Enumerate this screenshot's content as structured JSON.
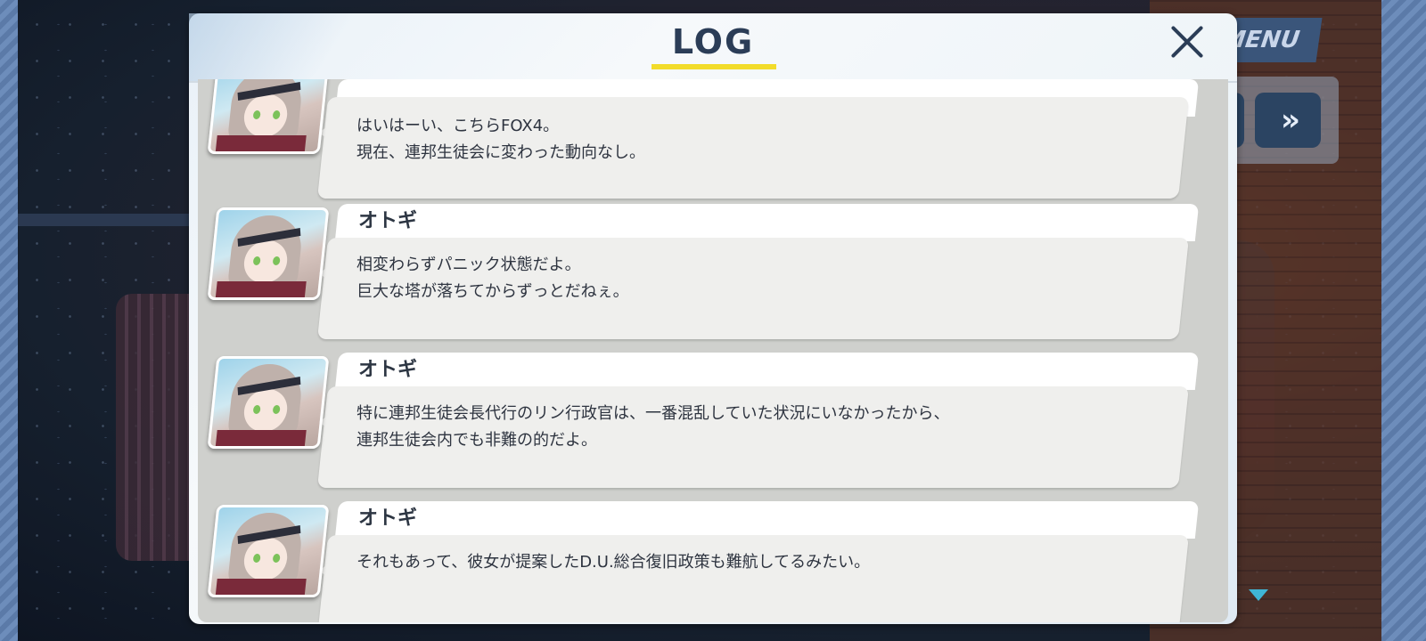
{
  "background": {
    "menu_label": "MENU",
    "fast_forward_label": "»"
  },
  "log": {
    "title": "LOG",
    "close_label": "×",
    "entries": [
      {
        "speaker": "",
        "lines": [
          "はいはーい、こちらFOX4。",
          "現在、連邦生徒会に変わった動向なし。"
        ]
      },
      {
        "speaker": "オトギ",
        "lines": [
          "相変わらずパニック状態だよ。",
          "巨大な塔が落ちてからずっとだねぇ。"
        ]
      },
      {
        "speaker": "オトギ",
        "lines": [
          "特に連邦生徒会長代行のリン行政官は、一番混乱していた状況にいなかったから、",
          "連邦生徒会内でも非難の的だよ。"
        ]
      },
      {
        "speaker": "オトギ",
        "lines": [
          "それもあって、彼女が提案したD.U.総合復旧政策も難航してるみたい。"
        ]
      }
    ]
  },
  "colors": {
    "title": "#2b3d57",
    "underline": "#f2dc2a",
    "accent_arrow": "#3fb6d6"
  },
  "icons": {
    "close": "close-icon",
    "fast_forward": "fast-forward-icon",
    "scroll_down": "scroll-down-arrow-icon"
  }
}
